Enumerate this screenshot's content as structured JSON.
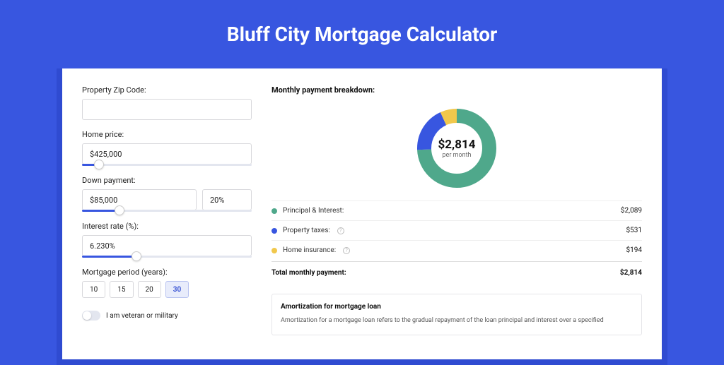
{
  "page": {
    "title": "Bluff City Mortgage Calculator"
  },
  "form": {
    "zip": {
      "label": "Property Zip Code:",
      "value": ""
    },
    "home_price": {
      "label": "Home price:",
      "value": "$425,000",
      "slider_pct": 10
    },
    "down_payment": {
      "label": "Down payment:",
      "value": "$85,000",
      "pct_value": "20%",
      "slider_pct": 22
    },
    "interest_rate": {
      "label": "Interest rate (%):",
      "value": "6.230%",
      "slider_pct": 32
    },
    "period": {
      "label": "Mortgage period (years):",
      "options": [
        "10",
        "15",
        "20",
        "30"
      ],
      "active": "30"
    },
    "veteran": {
      "label": "I am veteran or military",
      "value": false
    }
  },
  "breakdown": {
    "title": "Monthly payment breakdown:",
    "center_amount": "$2,814",
    "center_sub": "per month",
    "items": [
      {
        "label": "Principal & Interest:",
        "value": "$2,089",
        "color": "#4fa88b",
        "info": false
      },
      {
        "label": "Property taxes:",
        "value": "$531",
        "color": "#3856e0",
        "info": true
      },
      {
        "label": "Home insurance:",
        "value": "$194",
        "color": "#f1c84c",
        "info": true
      }
    ],
    "total_label": "Total monthly payment:",
    "total_value": "$2,814"
  },
  "amortization": {
    "title": "Amortization for mortgage loan",
    "text": "Amortization for a mortgage loan refers to the gradual repayment of the loan principal and interest over a specified"
  },
  "chart_data": {
    "type": "pie",
    "title": "Monthly payment breakdown",
    "series": [
      {
        "name": "Principal & Interest",
        "value": 2089,
        "color": "#4fa88b"
      },
      {
        "name": "Property taxes",
        "value": 531,
        "color": "#3856e0"
      },
      {
        "name": "Home insurance",
        "value": 194,
        "color": "#f1c84c"
      }
    ],
    "total": 2814
  }
}
